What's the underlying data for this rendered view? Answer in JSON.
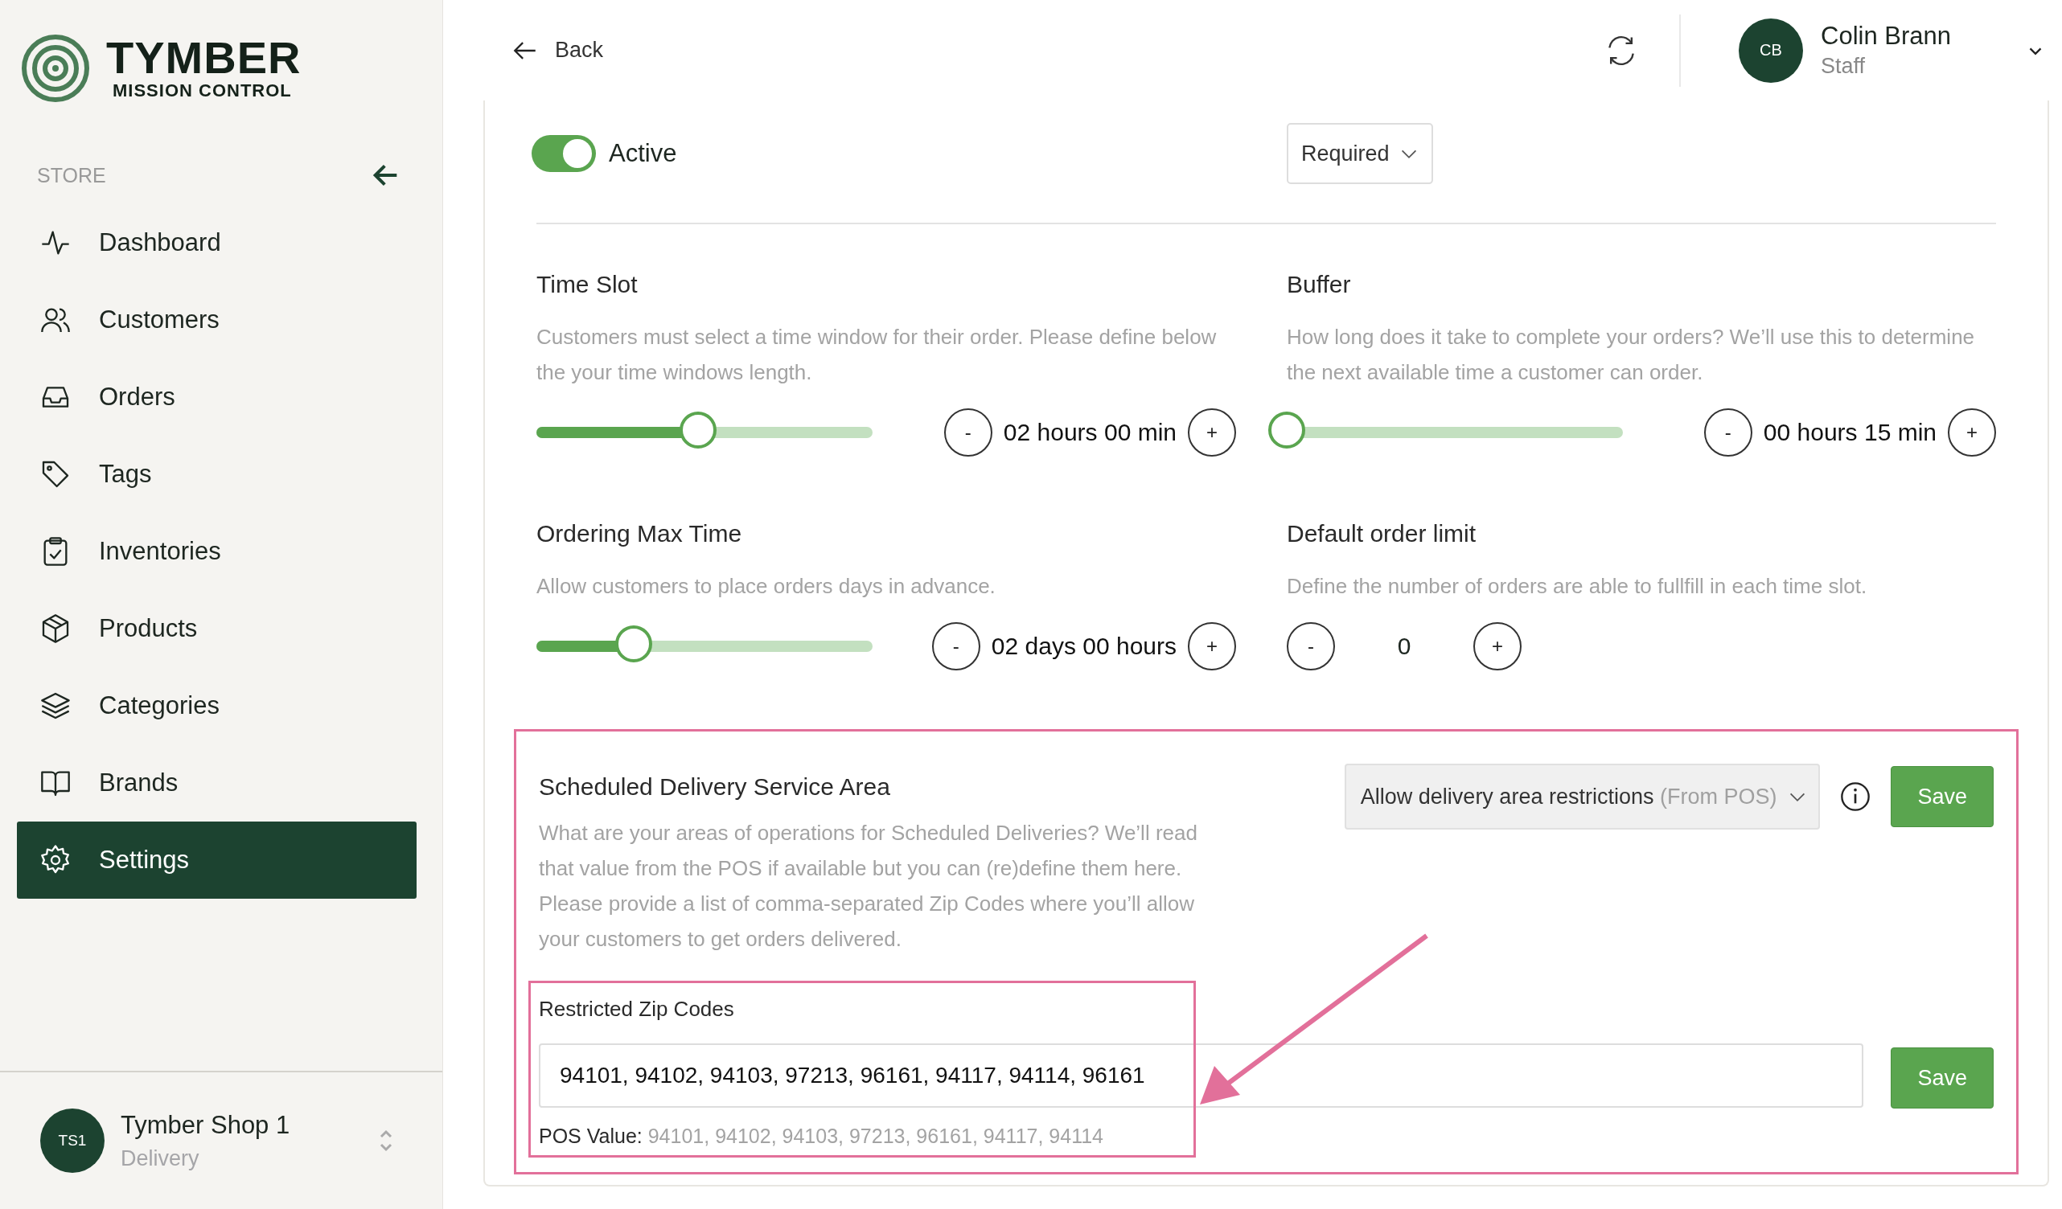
{
  "brand": {
    "name": "TYMBER",
    "tagline": "MISSION CONTROL"
  },
  "sidebar": {
    "section": "STORE",
    "items": [
      {
        "label": "Dashboard",
        "selected": false
      },
      {
        "label": "Customers",
        "selected": false
      },
      {
        "label": "Orders",
        "selected": false
      },
      {
        "label": "Tags",
        "selected": false
      },
      {
        "label": "Inventories",
        "selected": false
      },
      {
        "label": "Products",
        "selected": false
      },
      {
        "label": "Categories",
        "selected": false
      },
      {
        "label": "Brands",
        "selected": false
      },
      {
        "label": "Settings",
        "selected": true
      }
    ],
    "store": {
      "initials": "TS1",
      "name": "Tymber Shop 1",
      "mode": "Delivery"
    }
  },
  "header": {
    "back": "Back",
    "user": {
      "initials": "CB",
      "name": "Colin Brann",
      "role": "Staff"
    }
  },
  "status_toggle": {
    "on": true,
    "label": "Active"
  },
  "requirement_dropdown": {
    "value": "Required"
  },
  "settings": [
    {
      "kind": "slider",
      "title": "Time Slot",
      "description": "Customers must select a time window for their order. Please define below the your time windows length.",
      "level": 0.48,
      "decrement": "-",
      "reading": "02 hours 00 min",
      "increment": "+"
    },
    {
      "kind": "slider",
      "title": "Buffer",
      "description": "How long does it take to complete your orders? We’ll use this to determine the next available time a customer can order.",
      "level": 0,
      "decrement": "-",
      "reading": "00 hours 15 min",
      "increment": "+"
    },
    {
      "kind": "slider",
      "title": "Ordering Max Time",
      "description": "Allow customers to place orders days in advance.",
      "level": 0.29,
      "decrement": "-",
      "reading": "02 days 00 hours",
      "increment": "+"
    },
    {
      "kind": "counter",
      "title": "Default order limit",
      "description": "Define the number of orders are able to fullfill in each time slot.",
      "decrement": "-",
      "reading": "0",
      "increment": "+"
    }
  ],
  "delivery_area": {
    "title": "Scheduled Delivery Service Area",
    "description": "What are your areas of operations for Scheduled Deliveries? We’ll read that value from the POS if available but you can (re)define them here. Please provide a list of comma-separated Zip Codes where you’ll allow your customers to get orders delivered.",
    "dropdown": {
      "value": "Allow delivery area restrictions",
      "hint": "(From POS)"
    },
    "save": "Save",
    "zip_label": "Restricted Zip Codes",
    "zip_value": "94101, 94102, 94103, 97213, 96161, 94117, 94114, 96161",
    "zip_save": "Save",
    "pos_label": "POS Value:",
    "pos_value": "94101, 94102, 94103, 97213, 96161, 94117, 94114"
  }
}
